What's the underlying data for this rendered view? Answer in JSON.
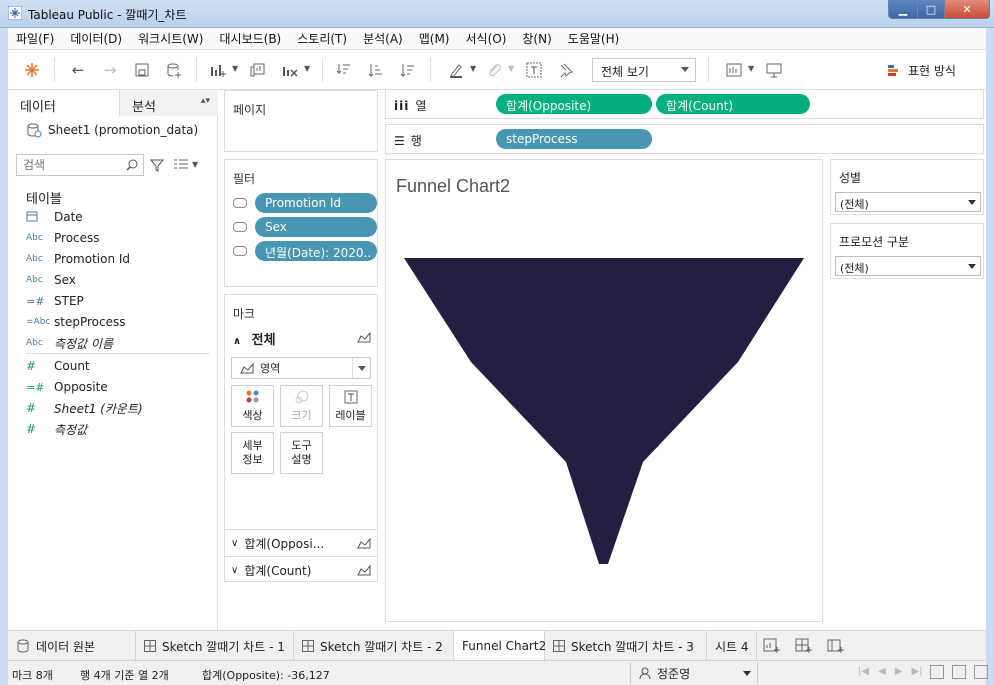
{
  "window": {
    "title": "Tableau Public - 깔때기_차트"
  },
  "menu": [
    "파일(F)",
    "데이터(D)",
    "워크시트(W)",
    "대시보드(B)",
    "스토리(T)",
    "분석(A)",
    "맵(M)",
    "서식(O)",
    "창(N)",
    "도움말(H)"
  ],
  "toolbar": {
    "fit": "전체 보기",
    "show_me": "표현 방식"
  },
  "data_pane": {
    "tab_data": "데이터",
    "tab_analysis": "분석",
    "datasource": "Sheet1 (promotion_data)",
    "search_placeholder": "검색",
    "tables_title": "테이블",
    "dimensions": [
      {
        "type": "date",
        "name": "Date"
      },
      {
        "type": "Abc",
        "name": "Process"
      },
      {
        "type": "Abc",
        "name": "Promotion Id"
      },
      {
        "type": "Abc",
        "name": "Sex"
      },
      {
        "type": "=#",
        "name": "STEP"
      },
      {
        "type": "=Abc",
        "name": "stepProcess"
      },
      {
        "type": "Abc",
        "name": "측정값 이름"
      }
    ],
    "measures": [
      {
        "type": "#",
        "name": "Count"
      },
      {
        "type": "=#",
        "name": "Opposite"
      },
      {
        "type": "#",
        "name": "Sheet1 (카운트)"
      },
      {
        "type": "#",
        "name": "측정값"
      }
    ]
  },
  "pages": {
    "title": "페이지"
  },
  "filters": {
    "title": "필터",
    "items": [
      "Promotion Id",
      "Sex",
      "년월(Date): 2020.."
    ]
  },
  "marks": {
    "title": "마크",
    "all_label": "전체",
    "mark_type": "영역",
    "buttons": {
      "color": "색상",
      "size": "크기",
      "label": "레이블",
      "detail": "세부\n정보",
      "tooltip": "도구\n설명"
    },
    "measure1": "합계(Opposi...",
    "measure2": "합계(Count)"
  },
  "shelves": {
    "columns_label": "열",
    "rows_label": "행",
    "columns": [
      "합계(Opposite)",
      "합계(Count)"
    ],
    "rows": [
      "stepProcess"
    ]
  },
  "sheet": {
    "title": "Funnel Chart2"
  },
  "quick_filters": [
    {
      "title": "성별",
      "value": "(전체)"
    },
    {
      "title": "프로모션 구분",
      "value": "(전체)"
    }
  ],
  "sheet_tabs": [
    "데이터 원본",
    "Sketch 깔때기 차트 - 1",
    "Sketch 깔때기 차트 - 2",
    "Funnel Chart2",
    "Sketch 깔때기 차트 - 3",
    "시트 4"
  ],
  "status": {
    "marks": "마크 8개",
    "rows_cols": "행 4개 기준 열 2개",
    "sum": "합계(Opposite): -36,127",
    "user": "정준영"
  },
  "colors": {
    "funnel": "#231f40",
    "dimension_pill": "#4996b2",
    "measure_pill": "#06b07e"
  }
}
